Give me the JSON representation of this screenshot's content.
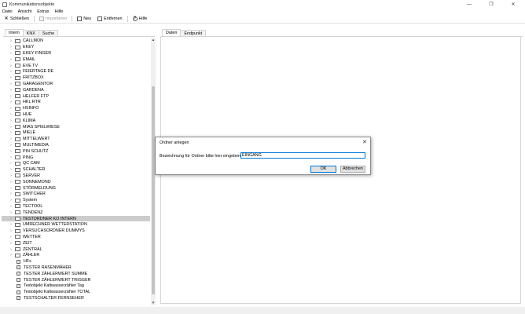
{
  "window": {
    "title": "Kommunikationsobjekte",
    "controls": [
      "—",
      "❐",
      "✕"
    ]
  },
  "menu": [
    "Datei",
    "Ansicht",
    "Extras",
    "Hilfe"
  ],
  "toolbar": {
    "close_label": "Schließen",
    "import_label": "Importieren",
    "new_label": "Neu",
    "delete_label": "Entfernen",
    "help_label": "Hilfe"
  },
  "left_tabs": [
    "Intern",
    "KNX",
    "Suche"
  ],
  "tree": {
    "folders": [
      "CALLMON",
      "EKEY",
      "EKEY FINGER",
      "EMAIL",
      "EVE TV",
      "FEIERTAGE DE",
      "FRITZBOX",
      "GARAGENTOR",
      "GARDENA",
      "HELFER FTP",
      "HKL RTR",
      "HSINFO",
      "HUE",
      "KLIMA",
      "MIAS SPIELWIESE",
      "MIELE",
      "MITTELWERT",
      "MULTIMEDIA",
      "PIN SCHUTZ",
      "PING",
      "QC CAM",
      "SCHALTER",
      "SERVER",
      "SONNEMOND",
      "STÖRMELDUNG",
      "SWITCHER",
      "System",
      "TECTOOL",
      "TENDENZ",
      "TESTORDNER KO INTERN",
      "UMRECHNER WETTERSTATION",
      "VERSUCHSORDNER DUMMYS",
      "WETTER",
      "ZEIT",
      "ZENTRAL",
      "ZÄHLER"
    ],
    "selected": "TESTORDNER KO INTERN",
    "objects": [
      "HFx",
      "TESTER RASENMÄHER",
      "TESTER ZÄHLERWERT SUMME",
      "TESTER ZÄHLERWERT TRIGGER",
      "Testobjekt Kaltwasserzähler Tag",
      "Testobjekt Kaltwasserzähler TOTAL",
      "TESTSCHALTER FERNSEHER"
    ]
  },
  "right_tabs": [
    "Daten",
    "Endpunkt"
  ],
  "dialog": {
    "title": "Ordner anlegen",
    "prompt": "Bezeichnung für Ordner bitte hier eingeben:",
    "value": "EINGANG",
    "ok_label": "OK",
    "cancel_label": "Abbrechen"
  }
}
